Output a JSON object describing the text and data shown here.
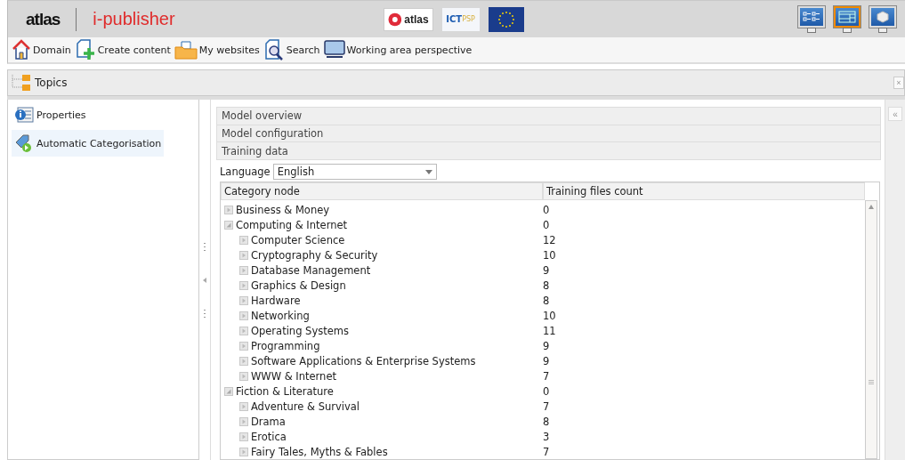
{
  "header": {
    "brand": "atlas",
    "product": "i-publisher",
    "partner_logos": [
      {
        "kind": "atlas",
        "text": "atlas"
      },
      {
        "kind": "ictpsp",
        "text": "ICT",
        "suffix": "PSP"
      },
      {
        "kind": "eu"
      }
    ],
    "perspectives": [
      {
        "kind": "grid",
        "selected": false
      },
      {
        "kind": "layout",
        "selected": true
      },
      {
        "kind": "box",
        "selected": false
      }
    ]
  },
  "toolbar": [
    {
      "kind": "home",
      "label": "Domain"
    },
    {
      "kind": "create",
      "label": "Create content"
    },
    {
      "kind": "folder",
      "label": "My websites"
    },
    {
      "kind": "search",
      "label": "Search"
    },
    {
      "kind": "monitor",
      "label": "Working area perspective"
    }
  ],
  "topics_tab": {
    "label": "Topics",
    "close": "×"
  },
  "sidebar": {
    "items": [
      {
        "kind": "info",
        "label": "Properties",
        "selected": false
      },
      {
        "kind": "tag",
        "label": "Automatic Categorisation",
        "selected": true
      }
    ]
  },
  "sections": [
    {
      "label": "Model overview"
    },
    {
      "label": "Model configuration"
    },
    {
      "label": "Training data"
    }
  ],
  "language": {
    "label": "Language",
    "value": "English"
  },
  "table": {
    "columns": [
      "Category node",
      "Training files count"
    ],
    "rows": [
      {
        "name": "Business & Money",
        "count": "0",
        "expanded": false,
        "children": []
      },
      {
        "name": "Computing & Internet",
        "count": "0",
        "expanded": true,
        "children": [
          {
            "name": "Computer Science",
            "count": "12"
          },
          {
            "name": "Cryptography & Security",
            "count": "10"
          },
          {
            "name": "Database Management",
            "count": "9"
          },
          {
            "name": "Graphics & Design",
            "count": "8"
          },
          {
            "name": "Hardware",
            "count": "8"
          },
          {
            "name": "Networking",
            "count": "10"
          },
          {
            "name": "Operating Systems",
            "count": "11"
          },
          {
            "name": "Programming",
            "count": "9"
          },
          {
            "name": "Software Applications & Enterprise Systems",
            "count": "9"
          },
          {
            "name": "WWW & Internet",
            "count": "7"
          }
        ]
      },
      {
        "name": "Fiction & Literature",
        "count": "0",
        "expanded": true,
        "children": [
          {
            "name": "Adventure & Survival",
            "count": "7"
          },
          {
            "name": "Drama",
            "count": "8"
          },
          {
            "name": "Erotica",
            "count": "3"
          },
          {
            "name": "Fairy Tales, Myths & Fables",
            "count": "7"
          }
        ]
      }
    ]
  },
  "collapse_button": "«"
}
